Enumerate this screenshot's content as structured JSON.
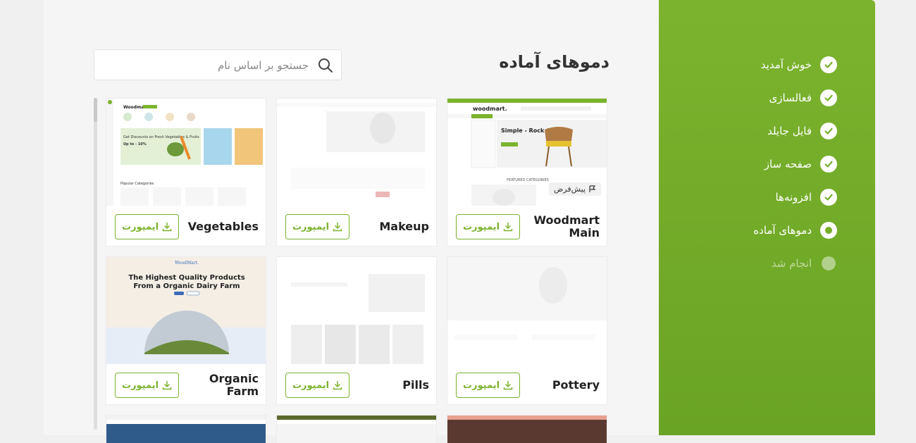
{
  "sidebar": {
    "steps": [
      {
        "label": "خوش آمدید",
        "state": "done"
      },
      {
        "label": "فعالسازی",
        "state": "done"
      },
      {
        "label": "فایل جایلد",
        "state": "done"
      },
      {
        "label": "صفحه ساز",
        "state": "done"
      },
      {
        "label": "افزونه‌ها",
        "state": "done"
      },
      {
        "label": "دموهای آماده",
        "state": "current"
      },
      {
        "label": "انجام شد",
        "state": "pending"
      }
    ]
  },
  "main": {
    "title": "دموهای آماده",
    "search_placeholder": "جستجو بر اساس نام"
  },
  "import_label": "ایمپورت",
  "default_badge": "پیش‌فرض",
  "demos": [
    {
      "name": "Woodmart Main",
      "default": true
    },
    {
      "name": "Makeup"
    },
    {
      "name": "Vegetables"
    },
    {
      "name": "Pottery"
    },
    {
      "name": "Pills"
    },
    {
      "name": "Organic Farm"
    }
  ],
  "thumbs": {
    "woodmart": {
      "logo": "woodmart.",
      "headline": "Simple - Rock Chair.",
      "section": "FEATURED CATEGORIES"
    },
    "vegetables": {
      "logo": "Woodmart",
      "promo": "Get Discounts on Fresh Vegetables & Fruits",
      "promo_sub": "Up to - 10%",
      "section": "Popular Categories"
    },
    "organic": {
      "logo": "WoodMart.",
      "headline_1": "The Highest Quality Products",
      "headline_2": "From a Organic Dairy Farm"
    }
  },
  "colors": {
    "accent": "#7cb32e",
    "sidebar_top": "#7cb32e",
    "sidebar_bottom": "#6aa424"
  }
}
